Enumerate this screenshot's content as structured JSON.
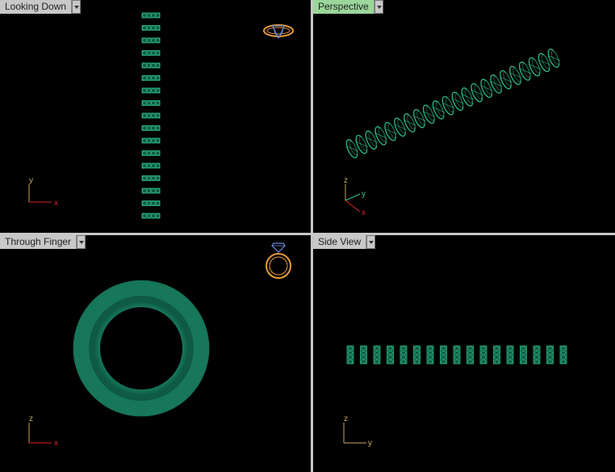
{
  "viewports": {
    "top": {
      "label": "Looking Down",
      "axes": [
        "y",
        "x"
      ]
    },
    "perspective": {
      "label": "Perspective",
      "axes": [
        "z",
        "y",
        "x"
      ]
    },
    "front": {
      "label": "Through Finger",
      "axes": [
        "z",
        "x"
      ]
    },
    "side": {
      "label": "Side View",
      "axes": [
        "z",
        "y"
      ]
    }
  },
  "colors": {
    "model": "#2fb88a",
    "model_dark": "#0f5a44",
    "axis_x": "#d22",
    "axis_y": "#3c9",
    "axis_v": "#c8a860",
    "active_tab": "#9bd69b",
    "ring_icon": "#e89a3a"
  },
  "icons": [
    "ring-side-icon",
    "ring-front-icon"
  ]
}
